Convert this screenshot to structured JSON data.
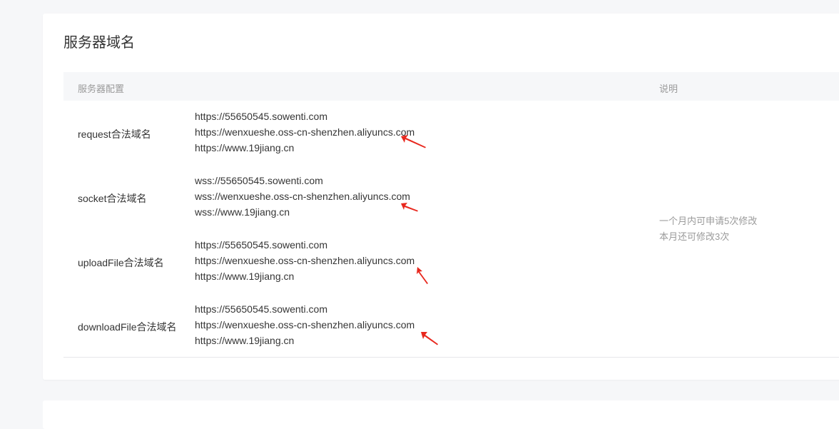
{
  "section": {
    "title": "服务器域名"
  },
  "table": {
    "headers": {
      "config": "服务器配置",
      "description": "说明"
    },
    "rows": [
      {
        "label": "request合法域名",
        "domains": [
          "https://55650545.sowenti.com",
          "https://wenxueshe.oss-cn-shenzhen.aliyuncs.com",
          "https://www.19jiang.cn"
        ]
      },
      {
        "label": "socket合法域名",
        "domains": [
          "wss://55650545.sowenti.com",
          "wss://wenxueshe.oss-cn-shenzhen.aliyuncs.com",
          "wss://www.19jiang.cn"
        ]
      },
      {
        "label": "uploadFile合法域名",
        "domains": [
          "https://55650545.sowenti.com",
          "https://wenxueshe.oss-cn-shenzhen.aliyuncs.com",
          "https://www.19jiang.cn"
        ]
      },
      {
        "label": "downloadFile合法域名",
        "domains": [
          "https://55650545.sowenti.com",
          "https://wenxueshe.oss-cn-shenzhen.aliyuncs.com",
          "https://www.19jiang.cn"
        ]
      }
    ],
    "description": {
      "line1": "一个月内可申请5次修改",
      "line2": "本月还可修改3次"
    }
  },
  "colors": {
    "page_background": "#f6f7f9",
    "card_background": "#ffffff",
    "header_background": "#f6f7f9",
    "primary_text": "#353535",
    "secondary_text": "#9a9a9a",
    "annotation_arrow": "#e8281e"
  },
  "icons": {
    "annotation": "red-arrow-icon"
  }
}
